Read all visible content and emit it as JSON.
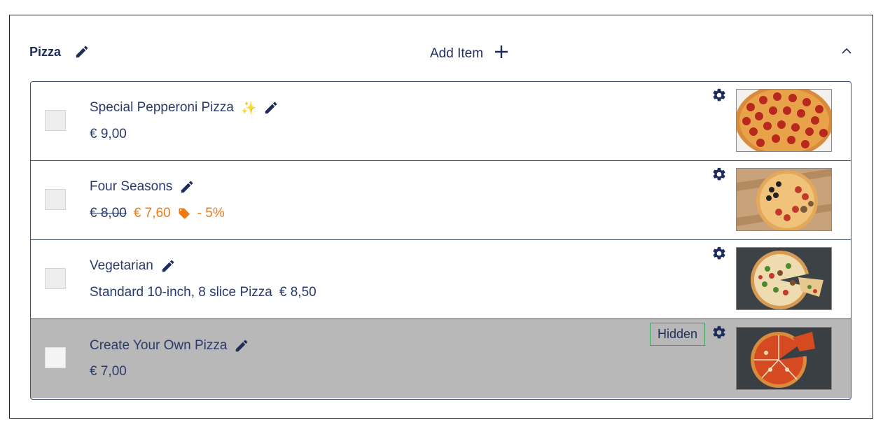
{
  "category": {
    "title": "Pizza",
    "add_item_label": "Add Item"
  },
  "colors": {
    "navy": "#1e2d5c",
    "discount": "#f07a12",
    "hidden_row_bg": "#b8b8b8",
    "hidden_badge_border": "#3aa55a"
  },
  "items": [
    {
      "name": "Special Pepperoni Pizza",
      "badge_emoji": "✨",
      "price": "€ 9,00",
      "image": "pepperoni pizza photo"
    },
    {
      "name": "Four Seasons",
      "old_price": "€ 8,00",
      "new_price": "€ 7,60",
      "discount": "- 5%",
      "image": "four seasons pizza photo"
    },
    {
      "name": "Vegetarian",
      "description": "Standard 10-inch, 8 slice Pizza",
      "price": "€ 8,50",
      "image": "vegetarian pizza photo"
    },
    {
      "name": "Create Your Own Pizza",
      "price": "€ 7,00",
      "status": "Hidden",
      "image": "tomato pizza photo"
    }
  ]
}
